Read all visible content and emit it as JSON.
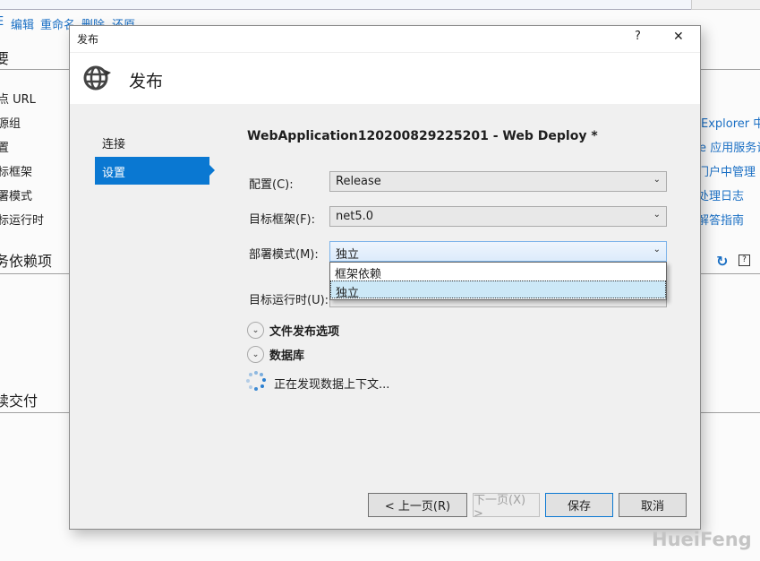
{
  "background": {
    "toolbar_links": [
      "编辑",
      "重命名",
      "删除",
      "还原"
    ],
    "left_items": [
      "点 URL",
      "源组",
      "置",
      "标框架",
      "署模式",
      "标运行时"
    ],
    "section_dependencies": "务依赖项",
    "section_delivery": "续交付",
    "section_top": "要",
    "right_links": [
      "Explorer 中",
      "re 应用服务设",
      "门户中管理",
      "处理日志",
      "解答指南"
    ]
  },
  "dialog": {
    "title": "发布",
    "help_label": "?",
    "close_label": "✕",
    "header_title": "发布",
    "nav": [
      {
        "label": "连接",
        "selected": false
      },
      {
        "label": "设置",
        "selected": true
      }
    ],
    "profile_title": "WebApplication120200829225201 - Web Deploy *",
    "fields": {
      "configuration": {
        "label": "配置(C):",
        "value": "Release"
      },
      "target_framework": {
        "label": "目标框架(F):",
        "value": "net5.0"
      },
      "deployment_mode": {
        "label": "部署模式(M):",
        "value": "独立",
        "options": [
          "框架依赖",
          "独立"
        ],
        "highlighted": "独立"
      },
      "target_runtime": {
        "label": "目标运行时(U):"
      }
    },
    "expanders": [
      "文件发布选项",
      "数据库"
    ],
    "status": "正在发现数据上下文...",
    "buttons": {
      "prev": "< 上一页(R)",
      "next": "下一页(X) >",
      "save": "保存",
      "cancel": "取消"
    }
  },
  "watermark": "HueiFeng",
  "colors": {
    "accent": "#0a78d2",
    "link": "#1a6fc4"
  }
}
